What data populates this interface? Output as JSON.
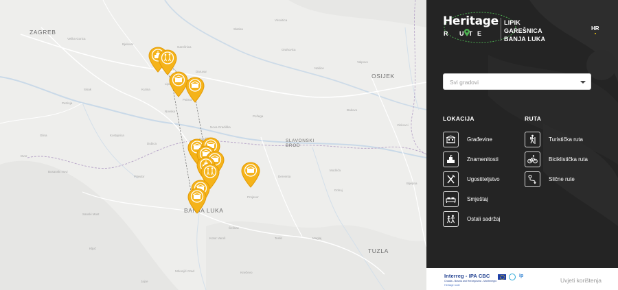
{
  "map": {
    "cities_major": [
      {
        "id": "zagreb",
        "name": "ZAGREB"
      },
      {
        "id": "osijek",
        "name": "OSIJEK"
      },
      {
        "id": "slavonski",
        "name": "SLAVONSKI\nBROD"
      },
      {
        "id": "banjaluka",
        "name": "BANJA LUKA"
      },
      {
        "id": "tuzla",
        "name": "TUZLA"
      }
    ],
    "towns": [
      {
        "id": "t1",
        "name": "Velika Gorica"
      },
      {
        "id": "t2",
        "name": "Sisak"
      },
      {
        "id": "t3",
        "name": "Petrinja"
      },
      {
        "id": "t4",
        "name": "Kutina"
      },
      {
        "id": "t5",
        "name": "Novska"
      },
      {
        "id": "t6",
        "name": "Daruvar"
      },
      {
        "id": "t7",
        "name": "Pakrac"
      },
      {
        "id": "t8",
        "name": "Nova Gradiška"
      },
      {
        "id": "t9",
        "name": "Požega"
      },
      {
        "id": "t10",
        "name": "Našice"
      },
      {
        "id": "t11",
        "name": "Đakovo"
      },
      {
        "id": "t12",
        "name": "Vinkovci"
      },
      {
        "id": "t13",
        "name": "Prijedor"
      },
      {
        "id": "t14",
        "name": "Doboj"
      },
      {
        "id": "t15",
        "name": "Prnjavor"
      },
      {
        "id": "t16",
        "name": "Bijeljina"
      },
      {
        "id": "t17",
        "name": "Kostajnica"
      },
      {
        "id": "t18",
        "name": "Dubica"
      },
      {
        "id": "t19",
        "name": "Gradiška"
      },
      {
        "id": "t20",
        "name": "Derventa"
      },
      {
        "id": "t21",
        "name": "Modriča"
      },
      {
        "id": "t22",
        "name": "Virovitica"
      },
      {
        "id": "t23",
        "name": "Bjelovar"
      },
      {
        "id": "t24",
        "name": "Garešnica"
      },
      {
        "id": "t25",
        "name": "Lipik"
      },
      {
        "id": "t26",
        "name": "Čelinac"
      },
      {
        "id": "t27",
        "name": "Kotor Varoš"
      },
      {
        "id": "t28",
        "name": "Teslić"
      },
      {
        "id": "t29",
        "name": "Maglaj"
      },
      {
        "id": "t30",
        "name": "Sanski Most"
      },
      {
        "id": "t31",
        "name": "Ključ"
      },
      {
        "id": "t32",
        "name": "Mrkonjić Grad"
      },
      {
        "id": "t33",
        "name": "Jajce"
      },
      {
        "id": "t34",
        "name": "Bosanski Novi"
      },
      {
        "id": "t35",
        "name": "Glina"
      },
      {
        "id": "t36",
        "name": "Dvor"
      },
      {
        "id": "t37",
        "name": "Orahovica"
      },
      {
        "id": "t38",
        "name": "Valpovo"
      },
      {
        "id": "t39",
        "name": "Slatina"
      },
      {
        "id": "t40",
        "name": "Kneževo"
      }
    ],
    "markers": [
      {
        "id": "m1",
        "category": "landmark-icon"
      },
      {
        "id": "m2",
        "category": "other-content-icon"
      },
      {
        "id": "m3",
        "category": "building-icon"
      },
      {
        "id": "m4",
        "category": "building-icon"
      },
      {
        "id": "m5",
        "category": "building-icon"
      },
      {
        "id": "m6",
        "category": "building-icon"
      },
      {
        "id": "m7",
        "category": "building-icon"
      },
      {
        "id": "m8",
        "category": "building-icon"
      },
      {
        "id": "m9",
        "category": "landmark-icon"
      },
      {
        "id": "m10",
        "category": "other-content-icon"
      },
      {
        "id": "m11",
        "category": "building-icon"
      },
      {
        "id": "m12",
        "category": "building-icon"
      },
      {
        "id": "m13",
        "category": "building-icon"
      }
    ],
    "marker_color": "#f5b31a"
  },
  "panel": {
    "logo": {
      "main": "Heritage",
      "sub": "R  UTE"
    },
    "route_names": [
      "LIPIK",
      "GAREŠNICA",
      "BANJA LUKA"
    ],
    "language": "HR",
    "city_select": {
      "placeholder": "Svi gradovi"
    },
    "location_section": {
      "title": "LOKACIJA",
      "items": [
        {
          "label": "Građevine",
          "icon": "building-icon"
        },
        {
          "label": "Znamenitosti",
          "icon": "landmark-icon"
        },
        {
          "label": "Ugostiteljstvo",
          "icon": "fork-knife-icon"
        },
        {
          "label": "Smještaj",
          "icon": "bed-icon"
        },
        {
          "label": "Ostali sadržaj",
          "icon": "other-content-icon"
        }
      ]
    },
    "route_section": {
      "title": "RUTA",
      "items": [
        {
          "label": "Turistička ruta",
          "icon": "hiker-icon"
        },
        {
          "label": "Biciklistička ruta",
          "icon": "bicycle-icon"
        },
        {
          "label": "Slične rute",
          "icon": "route-icon"
        }
      ]
    },
    "footer": {
      "interreg": "Interreg - IPA CBC",
      "interreg_sub": "Croatia - Bosnia and Herzegovina - Montenegro",
      "interreg_sub2": "Heritage route",
      "terms": "Uvjeti korištenja"
    },
    "colors": {
      "panel_bg": "#242424",
      "accent": "#f1c40f",
      "logo_green": "#4caf50"
    }
  }
}
